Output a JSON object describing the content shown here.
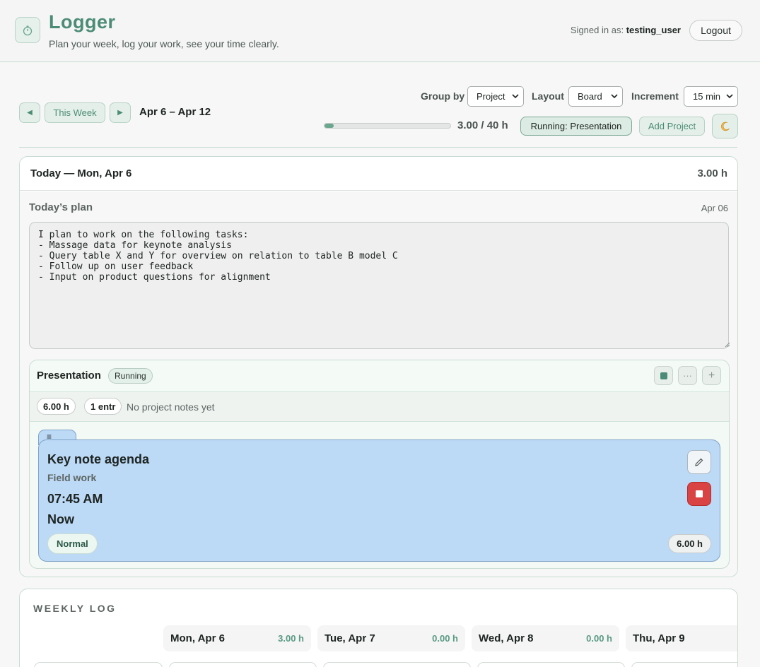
{
  "header": {
    "logo_icon": "stopwatch-icon",
    "title": "Logger",
    "tagline": "Plan your week, log your work, see your time clearly.",
    "signed_in_label": "Signed in as:",
    "username": "testing_user",
    "logout_label": "Logout"
  },
  "toolbar": {
    "prev_label": "◀",
    "this_week_label": "This Week",
    "next_label": "▶",
    "week_range": "Apr 6 – Apr 12",
    "group_by_label": "Group by",
    "group_by_value": "Project",
    "layout_label": "Layout",
    "layout_value": "Board",
    "increment_label": "Increment",
    "increment_value": "15 min",
    "progress_fraction": 0.075,
    "hours_total": "3.00 / 40 h",
    "running_label": "Running: Presentation",
    "add_project_label": "Add Project",
    "theme_icon": "moon-icon"
  },
  "today": {
    "title": "Today — Mon, Apr 6",
    "hours": "3.00 h",
    "plan_label": "Today’s plan",
    "plan_date": "Apr 06",
    "plan_text": "I plan to work on the following tasks:\n- Massage data for keynote analysis\n- Query table X and Y for overview on relation to table B model C\n- Follow up on user feedback\n- Input on product questions for alignment"
  },
  "project": {
    "name": "Presentation",
    "status": "Running",
    "hours_chip": "6.00 h",
    "entries_chip": "1 entr",
    "notes": "No project notes yet",
    "more_label": "···",
    "add_label": "+"
  },
  "entry": {
    "handle_label": "≡",
    "title": "Key note agenda",
    "category": "Field work",
    "start": "07:45 AM",
    "end": "Now",
    "tag": "Normal",
    "hours": "6.00 h",
    "color": "#bcd9f6"
  },
  "weekly": {
    "title": "WEEKLY LOG",
    "days": [
      {
        "name": "Mon, Apr 6",
        "hours": "3.00 h"
      },
      {
        "name": "Tue, Apr 7",
        "hours": "0.00 h"
      },
      {
        "name": "Wed, Apr 8",
        "hours": "0.00 h"
      },
      {
        "name": "Thu, Apr 9",
        "hours": ""
      }
    ]
  },
  "colors": {
    "accent": "#4c8c76",
    "danger": "#d94343",
    "entry_blue": "#bcd9f6"
  }
}
